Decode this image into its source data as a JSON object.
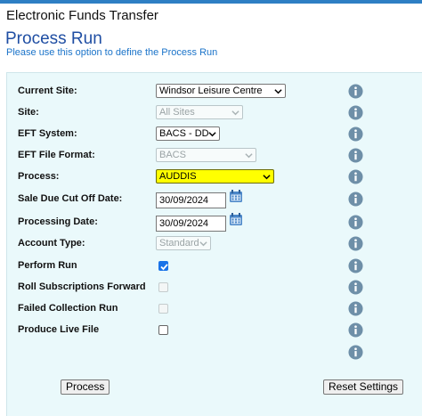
{
  "header": {
    "app_title": "Electronic Funds Transfer",
    "page_title": "Process Run",
    "subtitle": "Please use this option to define the Process Run"
  },
  "colors": {
    "accent": "#1f4ea3",
    "panel": "#eaf9fb",
    "highlight": "#ffff00",
    "info_icon": "#6e8fa8"
  },
  "form": {
    "current_site": {
      "label": "Current Site:",
      "value": "Windsor Leisure Centre"
    },
    "site": {
      "label": "Site:",
      "value": "All Sites"
    },
    "eft_system": {
      "label": "EFT System:",
      "value": "BACS - DD"
    },
    "eft_file_format": {
      "label": "EFT File Format:",
      "value": "BACS"
    },
    "process": {
      "label": "Process:",
      "value": "AUDDIS"
    },
    "sale_due_cut_off_date": {
      "label": "Sale Due Cut Off Date:",
      "value": "30/09/2024"
    },
    "processing_date": {
      "label": "Processing Date:",
      "value": "30/09/2024"
    },
    "account_type": {
      "label": "Account Type:",
      "value": "Standard"
    },
    "perform_run": {
      "label": "Perform Run",
      "checked": true
    },
    "roll_subscriptions_forward": {
      "label": "Roll Subscriptions Forward",
      "checked": false
    },
    "failed_collection_run": {
      "label": "Failed Collection Run",
      "checked": false
    },
    "produce_live_file": {
      "label": "Produce Live File",
      "checked": false
    }
  },
  "buttons": {
    "process": "Process",
    "reset_settings": "Reset Settings"
  }
}
